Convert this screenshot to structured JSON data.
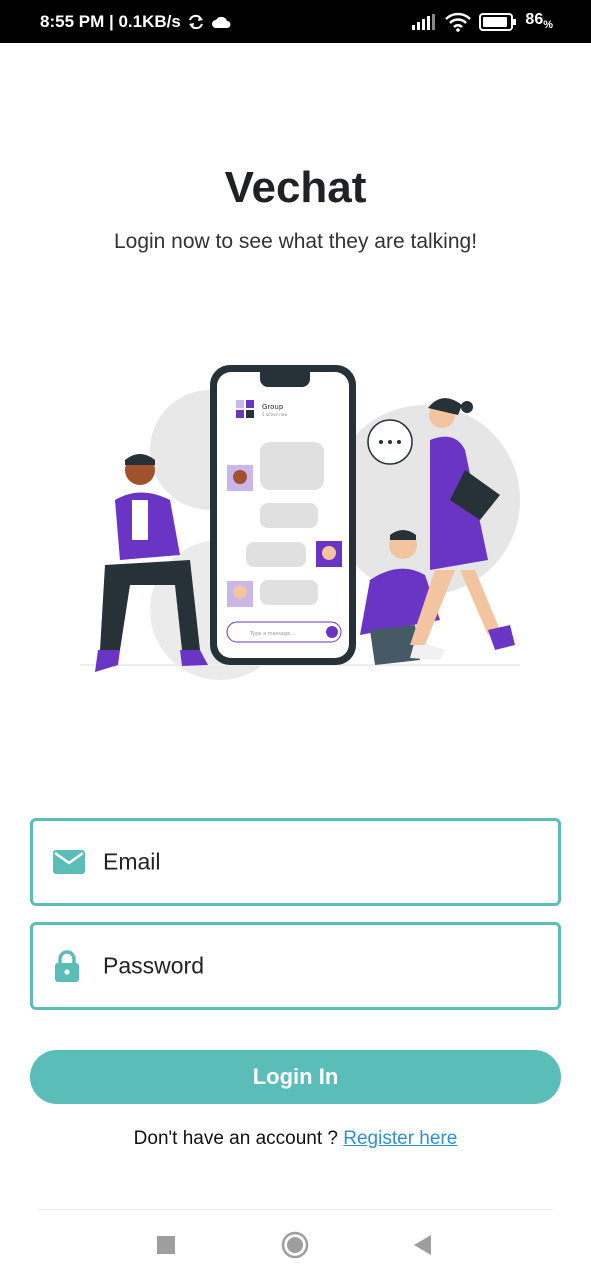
{
  "status_bar": {
    "time_speed": "8:55 PM | 0.1KB/s",
    "battery": "86",
    "battery_unit": "%",
    "icons": [
      "sync-icon",
      "cloud-icon",
      "signal-icon",
      "wifi-icon",
      "battery-icon"
    ]
  },
  "header": {
    "title": "Vechat",
    "subtitle": "Login now to see what they are talking!"
  },
  "illustration": {
    "group_label": "Group",
    "status_label": "5 active now",
    "input_placeholder": "Type a message..."
  },
  "form": {
    "email_label": "Email",
    "password_label": "Password",
    "login_label": "Login In",
    "register_prompt": "Don't have an account ? ",
    "register_link": "Register here"
  },
  "colors": {
    "accent": "#5bbdb7",
    "link": "#2f8fd6",
    "purple": "#6a35c5"
  },
  "nav": {
    "icons": [
      "recents-square-icon",
      "home-circle-icon",
      "back-triangle-icon"
    ]
  }
}
